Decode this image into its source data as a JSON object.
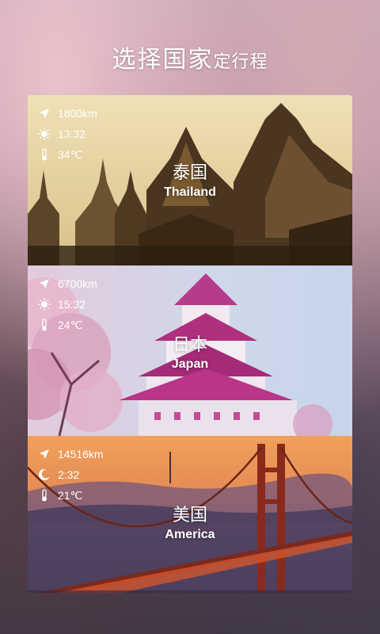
{
  "header": {
    "title_big": "选择国家",
    "title_small": "定行程"
  },
  "destinations": [
    {
      "name_cn": "泰国",
      "name_en": "Thailand",
      "distance": "1800km",
      "time": "13:32",
      "temperature": "34℃",
      "time_icon": "sun-icon"
    },
    {
      "name_cn": "日本",
      "name_en": "Japan",
      "distance": "6700km",
      "time": "15:32",
      "temperature": "24℃",
      "time_icon": "sun-icon"
    },
    {
      "name_cn": "美国",
      "name_en": "America",
      "distance": "14516km",
      "time": "2:32",
      "temperature": "21℃",
      "time_icon": "moon-icon"
    }
  ]
}
